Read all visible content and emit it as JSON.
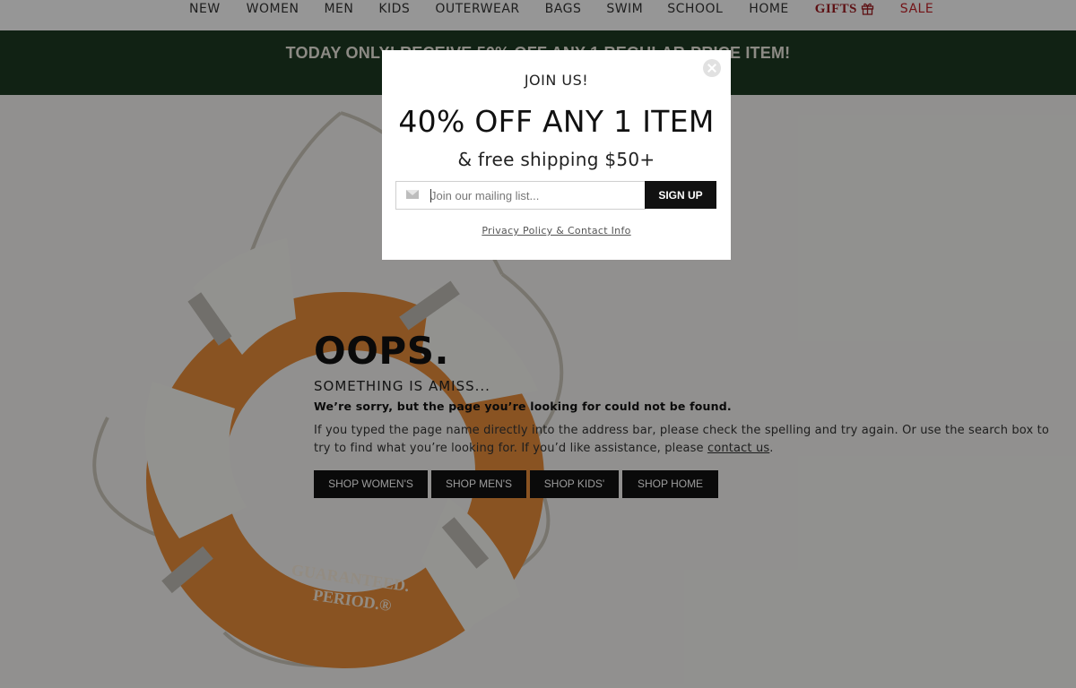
{
  "nav": {
    "items": [
      {
        "label": "NEW"
      },
      {
        "label": "WOMEN"
      },
      {
        "label": "MEN"
      },
      {
        "label": "KIDS"
      },
      {
        "label": "OUTERWEAR"
      },
      {
        "label": "BAGS"
      },
      {
        "label": "SWIM"
      },
      {
        "label": "SCHOOL"
      },
      {
        "label": "HOME"
      }
    ],
    "gifts_label": "GIFTS",
    "gifts_icon": "gift-icon",
    "sale_label": "SALE",
    "colors": {
      "gifts": "#9b1b20",
      "sale": "#c02027"
    }
  },
  "promo": {
    "text": "TODAY ONLY! RECEIVE 50% OFF ANY 1 REGULAR-PRICE ITEM!",
    "background": "#1d3a22"
  },
  "hero": {
    "ring_text_line1": "GUARANTEED.",
    "ring_text_line2": "PERIOD.®",
    "ring_color": "#e58a3a"
  },
  "error": {
    "title": "OOPS.",
    "subtitle": "SOMETHING IS AMISS...",
    "sorry": "We’re sorry, but the page you’re looking for could not be found.",
    "para_before_link": "If you typed the page name directly into the address bar, please check the spelling and try again. Or use the search box to try to find what you’re looking for. If you’d like assistance, please ",
    "link_text": "contact us",
    "para_after_link": ".",
    "buttons": [
      {
        "label": "SHOP WOMEN'S"
      },
      {
        "label": "SHOP MEN'S"
      },
      {
        "label": "SHOP KIDS'"
      },
      {
        "label": "SHOP HOME"
      }
    ]
  },
  "modal": {
    "heading": "JOIN US!",
    "headline": "40% OFF ANY 1 ITEM",
    "subheadline": "& free shipping $50+",
    "email_placeholder": "Join our mailing list...",
    "email_value": "",
    "signup_label": "SIGN UP",
    "privacy_link": "Privacy Policy & Contact Info",
    "close_icon": "close-icon",
    "envelope_icon": "envelope-icon"
  }
}
